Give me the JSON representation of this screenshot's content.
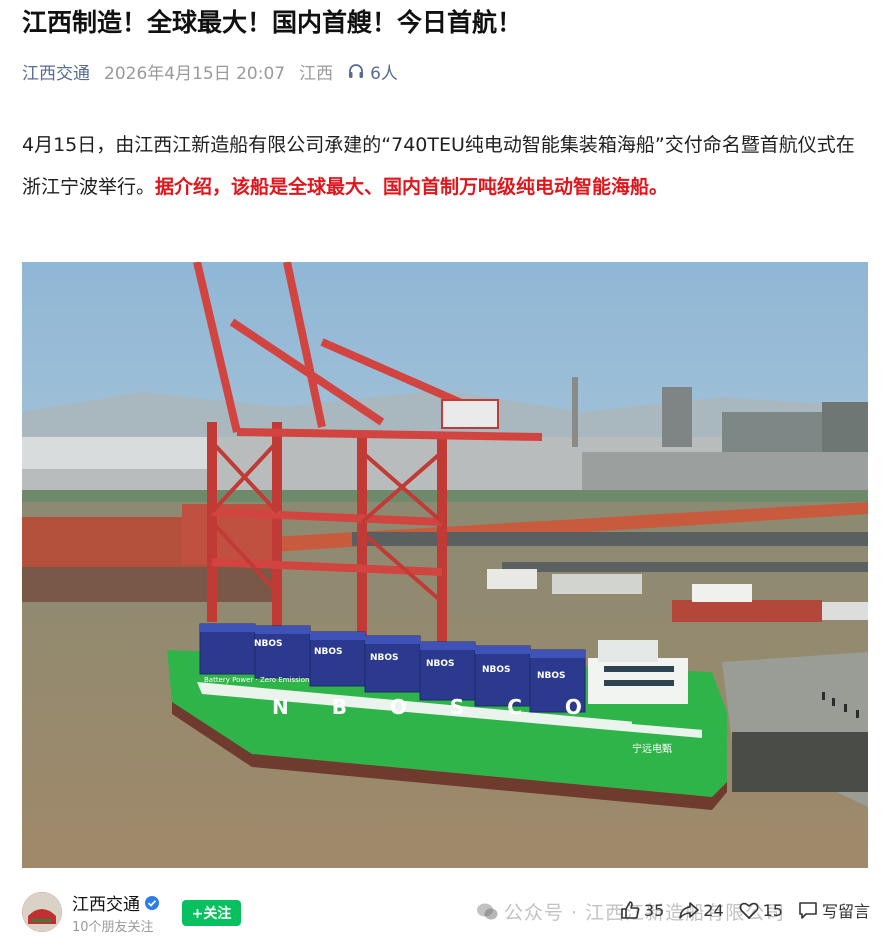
{
  "article": {
    "title": "江西制造！全球最大！国内首艘！今日首航！",
    "source": "江西交通",
    "timestamp": "2026年4月15日 20:07",
    "location": "江西",
    "listeners": "6人",
    "para_part1": "4月15日，由江西江新造船有限公司承建的“740TEU纯电动智能集装箱海船”交付命名暨首航仪式在浙江宁波举行。",
    "para_part2": "据介绍，该船是全球最大、国内首制万吨级纯电动智能海船。"
  },
  "photo": {
    "hull_text": "N B O S C O",
    "container_text": "NBOS",
    "bow_text": "宁远电甄",
    "side_text": "Battery Power · Zero Emission"
  },
  "footer": {
    "account_name": "江西交通",
    "friends_following": "10个朋友关注",
    "follow_label": "+关注",
    "watermark": "公众号 · 江西江新造船有限公司",
    "likes": "35",
    "shares": "24",
    "favorites": "15",
    "comment_label": "写留言"
  },
  "colors": {
    "accent_red": "#e0161c",
    "link_blue": "#576b95",
    "follow_green": "#07c160",
    "hull_green": "#2fb44a"
  },
  "icons": [
    "headphones-icon",
    "verified-icon",
    "wechat-icon",
    "like-icon",
    "share-icon",
    "heart-icon",
    "comment-icon"
  ]
}
